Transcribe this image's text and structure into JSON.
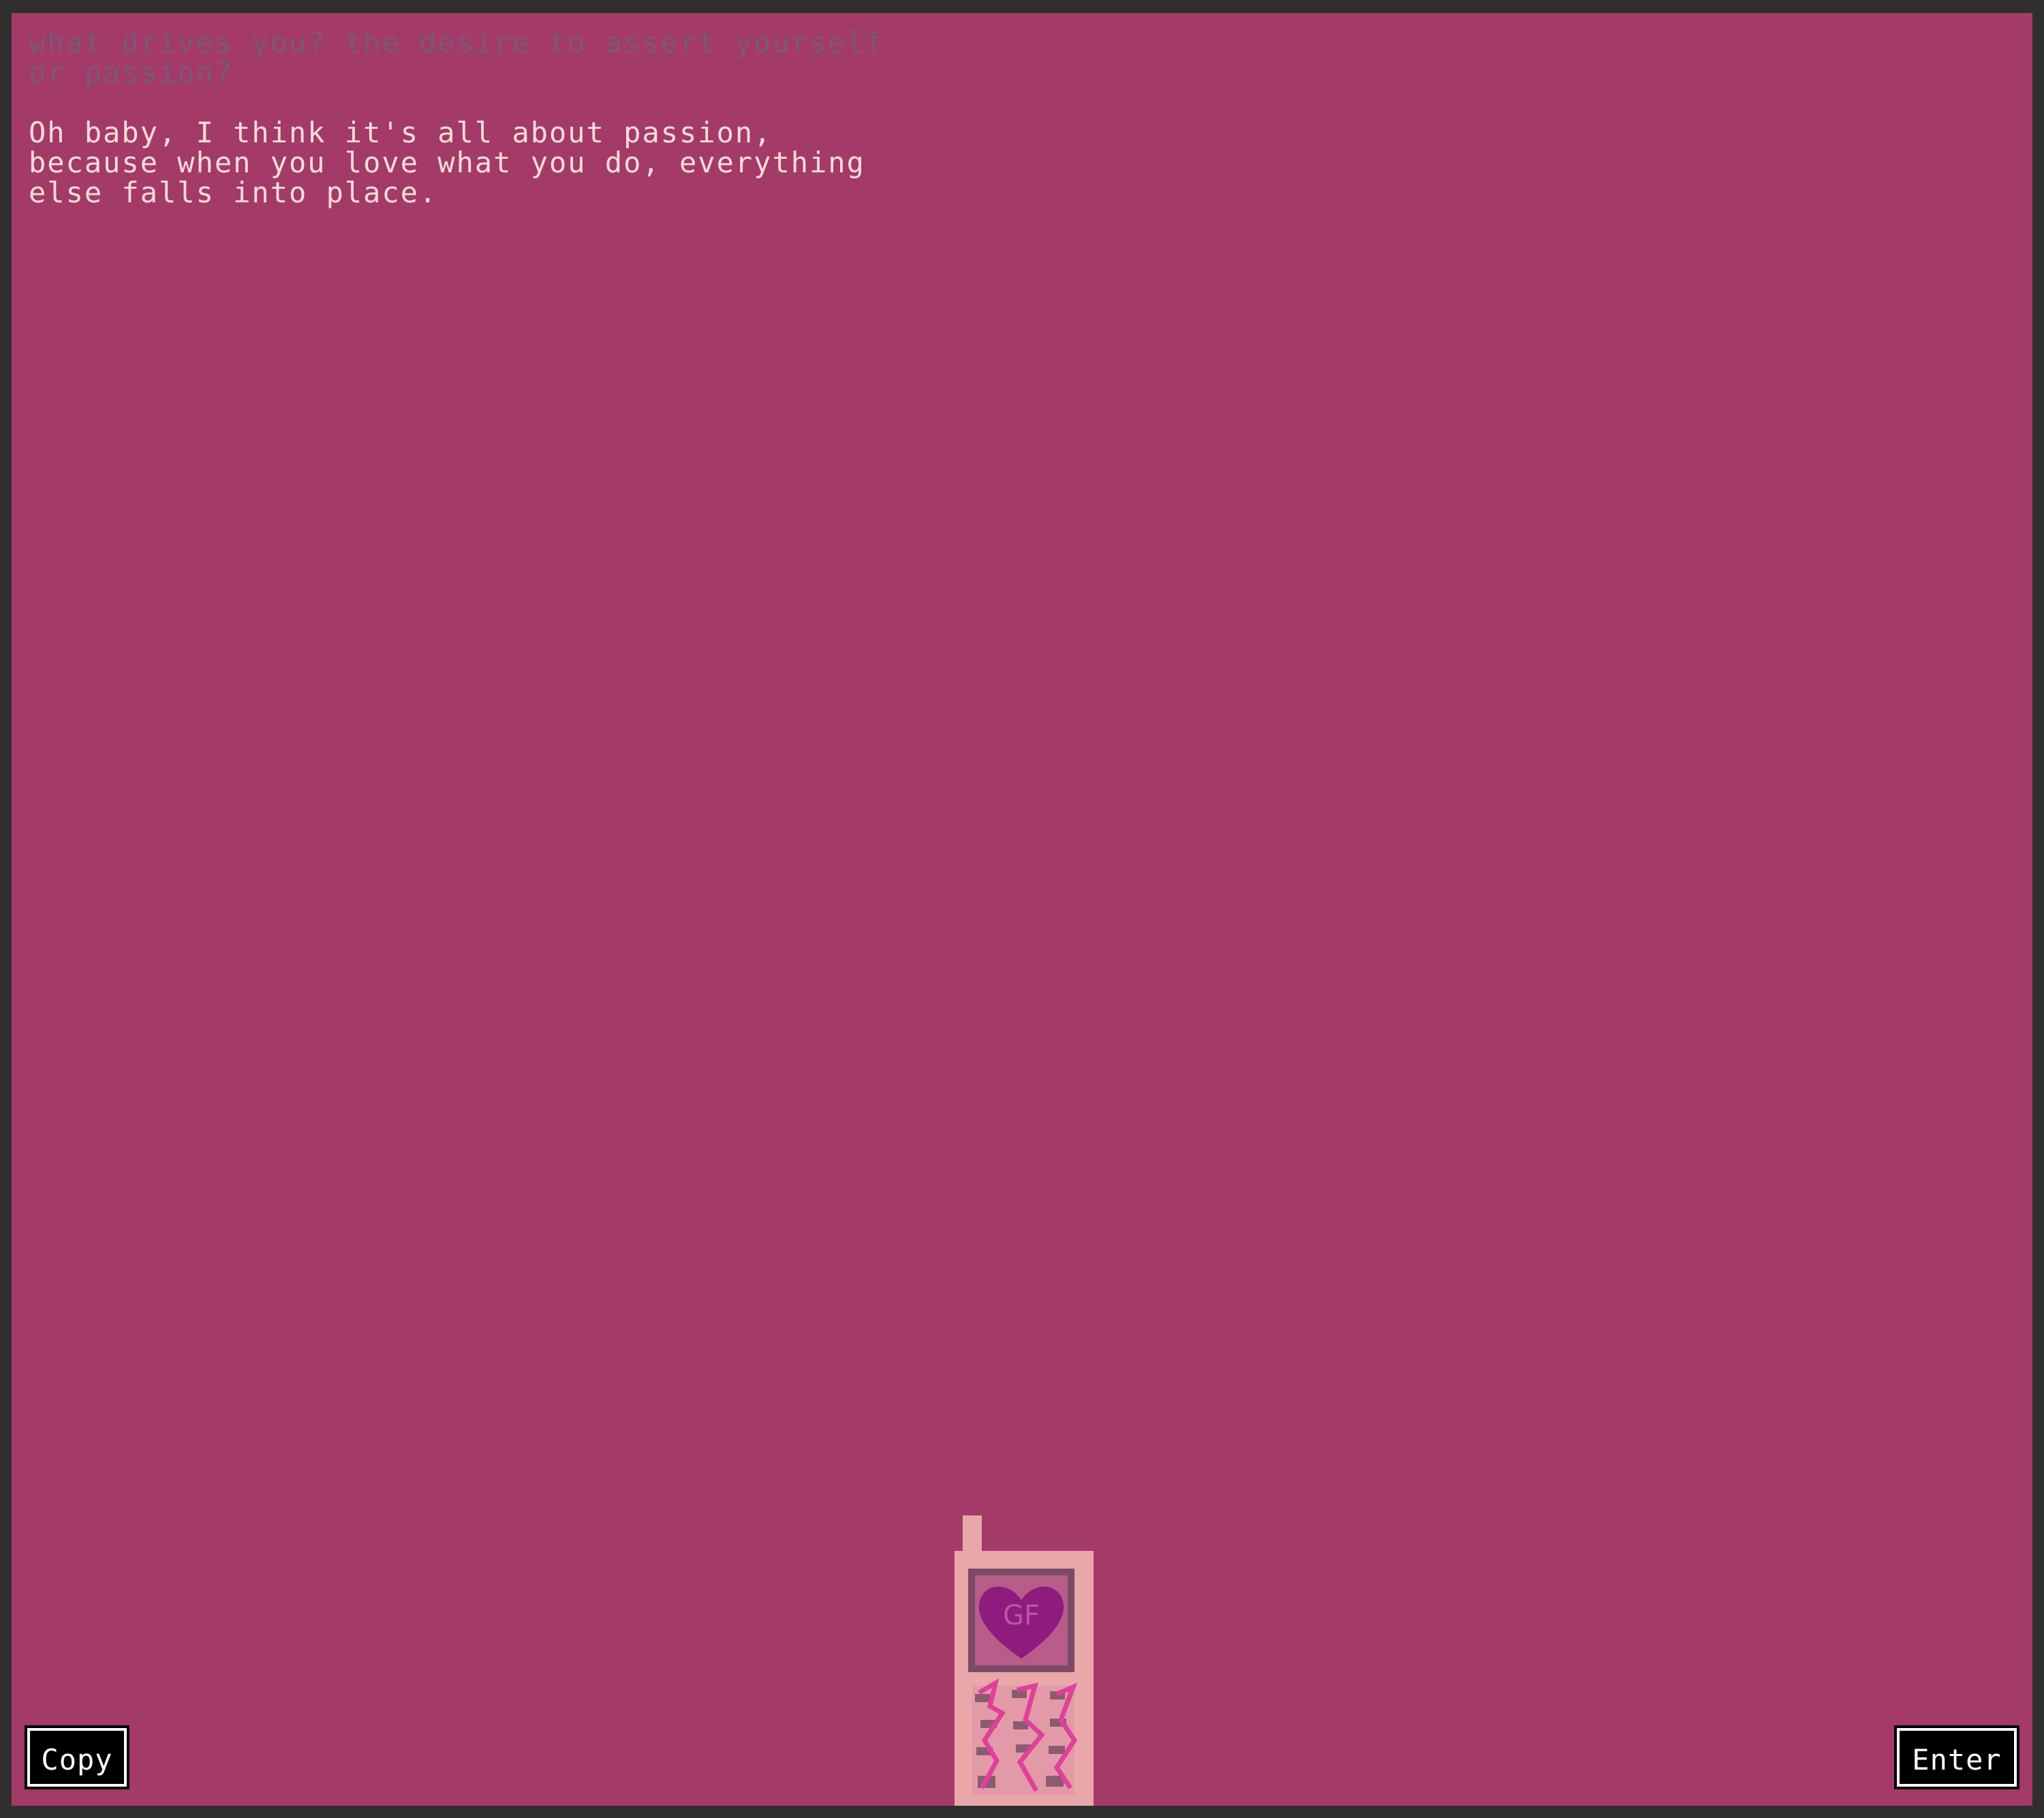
{
  "conversation": {
    "prompt": "what drives you? the desire to assert yourself\nor passion?",
    "reply": "Oh baby, I think it's all about passion,\nbecause when you love what you do, everything\nelse falls into place."
  },
  "buttons": {
    "copy_label": "Copy",
    "enter_label": "Enter"
  },
  "colors": {
    "background": "#a43a67",
    "frame": "#2f2f2f",
    "prompt_text": "#7a5878",
    "reply_text": "#f6dcd8",
    "phone_body": "#e9a7a9",
    "heart": "#8f1b7e"
  },
  "phone": {
    "icon": "flip-phone-icon",
    "screen_icon": "heart-icon",
    "logo_text": "GF"
  }
}
